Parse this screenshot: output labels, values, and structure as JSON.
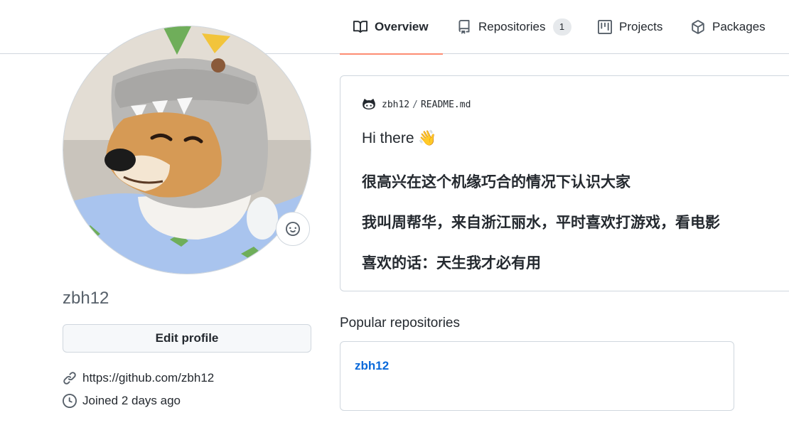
{
  "tabs": [
    {
      "label": "Overview",
      "icon": "book-icon",
      "selected": true
    },
    {
      "label": "Repositories",
      "icon": "repo-icon",
      "count": "1"
    },
    {
      "label": "Projects",
      "icon": "project-icon"
    },
    {
      "label": "Packages",
      "icon": "package-icon"
    }
  ],
  "profile": {
    "username": "zbh12",
    "edit_button": "Edit profile",
    "website": "https://github.com/zbh12",
    "joined": "Joined 2 days ago",
    "avatar_icon": "shiba-dog-in-dinosaur-hood-photo"
  },
  "readme": {
    "owner": "zbh12",
    "separator": "/",
    "file": "README.md",
    "lines": [
      "Hi there 👋",
      "很高兴在这个机缘巧合的情况下认识大家",
      "我叫周帮华，来自浙江丽水，平时喜欢打游戏，看电影",
      "喜欢的话：天生我才必有用"
    ]
  },
  "popular": {
    "title": "Popular repositories",
    "repos": [
      {
        "name": "zbh12"
      }
    ]
  },
  "colors": {
    "accent_underline": "#fd8c73",
    "link": "#0969da",
    "border": "#d0d7de"
  }
}
